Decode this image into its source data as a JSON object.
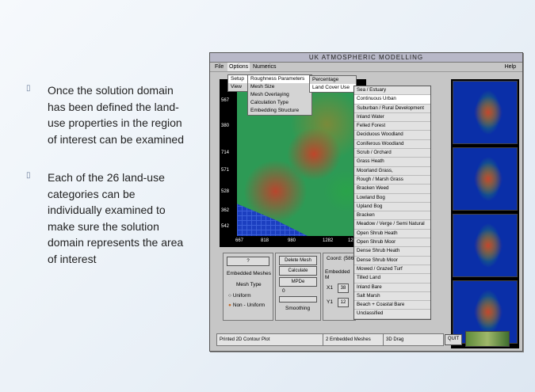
{
  "bullets": [
    {
      "text": "Once the solution domain has been defined the land-use properties in the region of interest can be examined"
    },
    {
      "text": "Each of the 26 land-use categories can be individually examined to make sure the solution domain represents the area of interest"
    }
  ],
  "window": {
    "title": "UK ATMOSPHERIC MODELLING",
    "menu": {
      "file": "File",
      "options": "Options",
      "numerics": "Numerics",
      "help": "Help"
    },
    "setup": "Setup",
    "view": "View",
    "options_menu": [
      "Roughness Parameters",
      "Mesh Size",
      "Mesh Overlaying",
      "Calculation Type",
      "Embedding Structure"
    ],
    "percentage": "Percentage",
    "land_cover_use": "Land Cover Use",
    "map_ticks_y": [
      "567",
      "380",
      "714",
      "571",
      "528",
      "362",
      "542"
    ],
    "map_ticks_x": [
      "667",
      "818",
      "980",
      "1282",
      "126"
    ]
  },
  "land_use": [
    "Sea / Estuary",
    "Continuous Urban",
    "Suburban / Rural Development",
    "Inland Water",
    "Felled Forest",
    "Deciduous Woodland",
    "Coniferous Woodland",
    "Scrub / Orchard",
    "Grass Heath",
    "Moorland Grass,",
    "Rough / Marsh Grass",
    "Bracken Weed",
    "Lowland Bog",
    "Upland Bog",
    "Bracken",
    "Meadow / Verge / Semi Natural",
    "Open Shrub Heath",
    "Open Shrub Moor",
    "Dense Shrub Heath",
    "Dense Shrub Moor",
    "Mowed / Grazed Turf",
    "Tilled Land",
    "Inland Bare",
    "Salt Marsh",
    "Beach + Coastal Bare",
    "Unclassified"
  ],
  "controls": {
    "embedded_meshes": "Embedded Meshes",
    "mesh_type": "Mesh Type",
    "uniform": "Uniform",
    "non_uniform": "Non - Uniform",
    "delete_mesh": "Delete Mesh",
    "calculate": "Calculate",
    "mpde": "MPDe",
    "smoothing": "Smoothing",
    "coord": "Coord: (586",
    "embedded": "Embedded M",
    "x1": "X1",
    "y1": "Y1",
    "x1_val": "38",
    "y1_val": "12",
    "zero": "0",
    "q": "?"
  },
  "status": {
    "left": "Printed 2D Contour Plot",
    "mid": "2 Embedded Meshes",
    "right": "3D Drag",
    "quit": "QUIT"
  }
}
